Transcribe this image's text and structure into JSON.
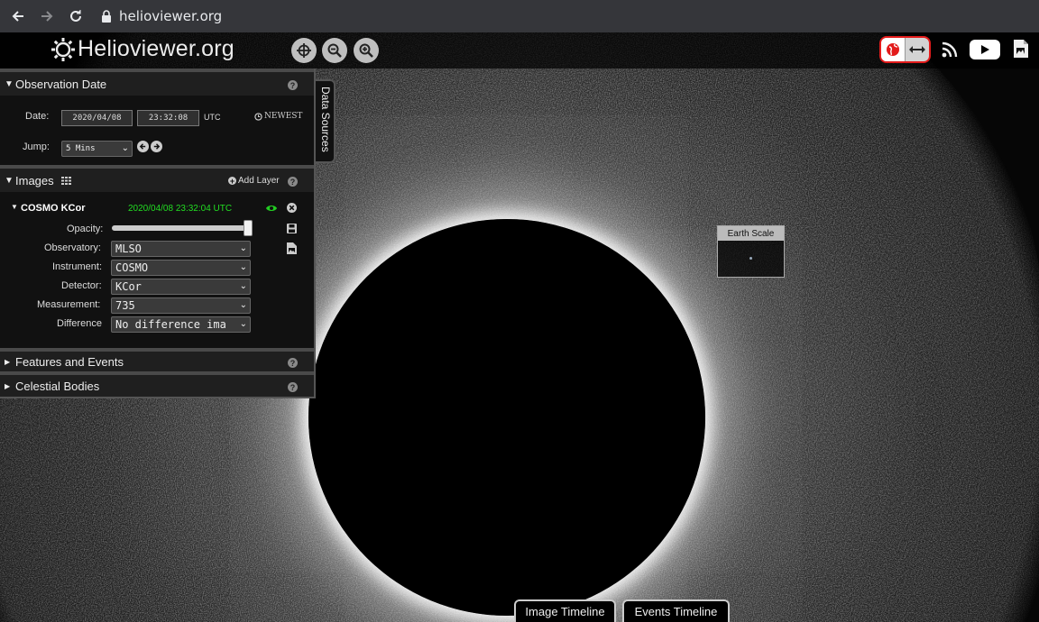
{
  "browser": {
    "url": "helioviewer.org"
  },
  "header": {
    "logo_text": "Helioviewer.org"
  },
  "observation": {
    "title": "Observation Date",
    "date_label": "Date:",
    "date_value": "2020/04/08",
    "time_value": "23:32:08",
    "utc_label": "UTC",
    "newest_label": "NEWEST",
    "jump_label": "Jump:",
    "jump_value": "5 Mins"
  },
  "images": {
    "title": "Images",
    "add_layer_label": "Add Layer",
    "layer": {
      "name": "COSMO KCor",
      "timestamp": "2020/04/08 23:32:04 UTC",
      "opacity_label": "Opacity:",
      "opacity": 1.0,
      "observatory_label": "Observatory:",
      "observatory_value": "MLSO",
      "instrument_label": "Instrument:",
      "instrument_value": "COSMO",
      "detector_label": "Detector:",
      "detector_value": "KCor",
      "measurement_label": "Measurement:",
      "measurement_value": "735",
      "difference_label": "Difference",
      "difference_value": "No difference ima"
    }
  },
  "features": {
    "title": "Features and Events"
  },
  "celestial": {
    "title": "Celestial Bodies"
  },
  "data_sources_tab": "Data Sources",
  "earth_scale": {
    "title": "Earth Scale"
  },
  "timelines": {
    "image_label": "Image Timeline",
    "events_label": "Events Timeline"
  },
  "colors": {
    "timestamp_green": "#22dd22",
    "eye_green": "#22cc22",
    "toggle_border": "#e31b1b"
  }
}
